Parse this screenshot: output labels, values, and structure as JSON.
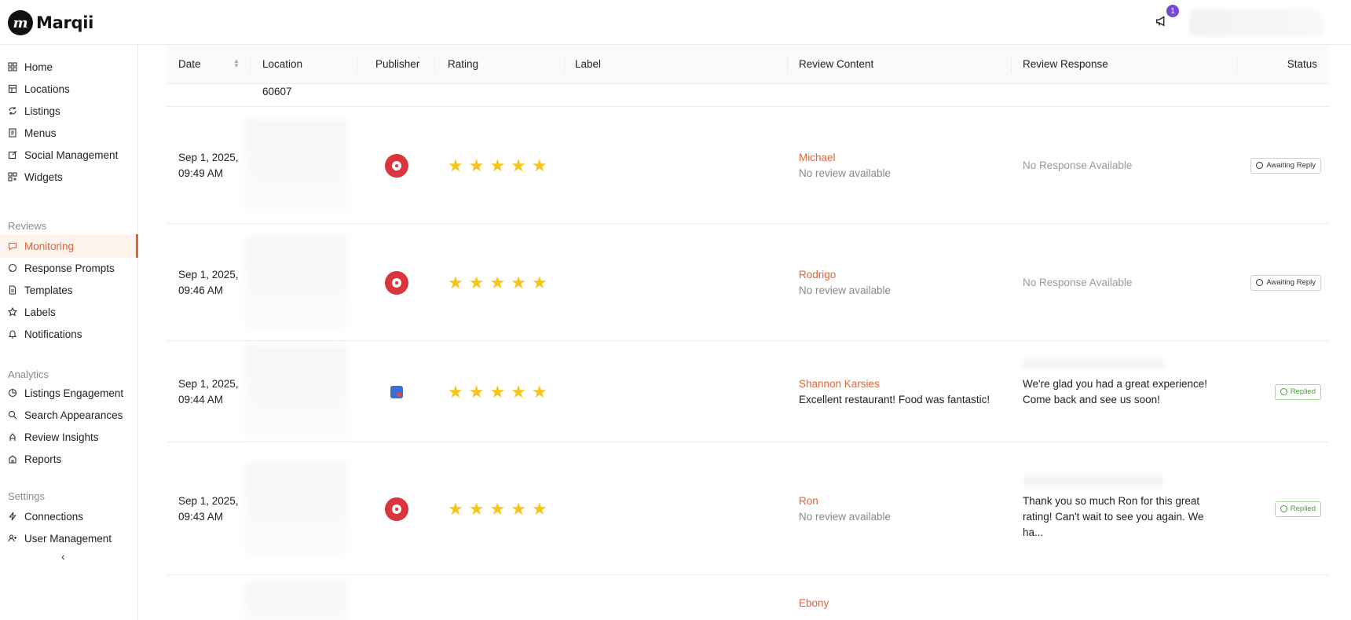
{
  "app": {
    "name": "Marqii",
    "notification_count": "1"
  },
  "sidebar": {
    "items_main": [
      {
        "label": "Home",
        "icon": "grid-icon"
      },
      {
        "label": "Locations",
        "icon": "building-icon"
      },
      {
        "label": "Listings",
        "icon": "refresh-icon"
      },
      {
        "label": "Menus",
        "icon": "menu-doc-icon"
      },
      {
        "label": "Social Management",
        "icon": "edit-icon"
      },
      {
        "label": "Widgets",
        "icon": "widgets-icon"
      }
    ],
    "section_reviews": "Reviews",
    "items_reviews": [
      {
        "label": "Monitoring",
        "icon": "chat-icon",
        "active": true
      },
      {
        "label": "Response Prompts",
        "icon": "message-icon"
      },
      {
        "label": "Templates",
        "icon": "document-icon"
      },
      {
        "label": "Labels",
        "icon": "star-outline-icon"
      },
      {
        "label": "Notifications",
        "icon": "bell-icon"
      }
    ],
    "section_analytics": "Analytics",
    "items_analytics": [
      {
        "label": "Listings Engagement",
        "icon": "pie-icon"
      },
      {
        "label": "Search Appearances",
        "icon": "search-icon"
      },
      {
        "label": "Review Insights",
        "icon": "insights-icon"
      },
      {
        "label": "Reports",
        "icon": "report-icon"
      }
    ],
    "section_settings": "Settings",
    "items_settings": [
      {
        "label": "Connections",
        "icon": "bolt-icon"
      },
      {
        "label": "User Management",
        "icon": "users-icon"
      }
    ]
  },
  "table": {
    "headers": [
      "Date",
      "Location",
      "Publisher",
      "Rating",
      "Label",
      "Review Content",
      "Review Response",
      "Status"
    ],
    "partial_location": "60607",
    "rows": [
      {
        "date1": "Sep 1, 2025,",
        "date2": "09:49 AM",
        "publisher": "yelp",
        "rating": 5,
        "reviewer": "Michael",
        "review": "No review available",
        "review_muted": true,
        "response1": "No Response Available",
        "response2": "",
        "response_muted": true,
        "status": "Awaiting Reply"
      },
      {
        "date1": "Sep 1, 2025,",
        "date2": "09:46 AM",
        "publisher": "yelp",
        "rating": 5,
        "reviewer": "Rodrigo",
        "review": "No review available",
        "review_muted": true,
        "response1": "No Response Available",
        "response2": "",
        "response_muted": true,
        "status": "Awaiting Reply"
      },
      {
        "date1": "Sep 1, 2025,",
        "date2": "09:44 AM",
        "publisher": "google",
        "rating": 5,
        "reviewer": "Shannon Karsies",
        "review": "Excellent restaurant! Food was fantastic!",
        "review_muted": false,
        "response1": "We're glad you had a great experience!",
        "response2": "Come back and see us soon!",
        "response_muted": false,
        "status": "Replied"
      },
      {
        "date1": "Sep 1, 2025,",
        "date2": "09:43 AM",
        "publisher": "yelp",
        "rating": 5,
        "reviewer": "Ron",
        "review": "No review available",
        "review_muted": true,
        "response1": "Thank you so much Ron for this great",
        "response2": "rating! Can't wait to see you again. We ha...",
        "response_muted": false,
        "status": "Replied"
      },
      {
        "reviewer": "Ebony"
      }
    ]
  }
}
